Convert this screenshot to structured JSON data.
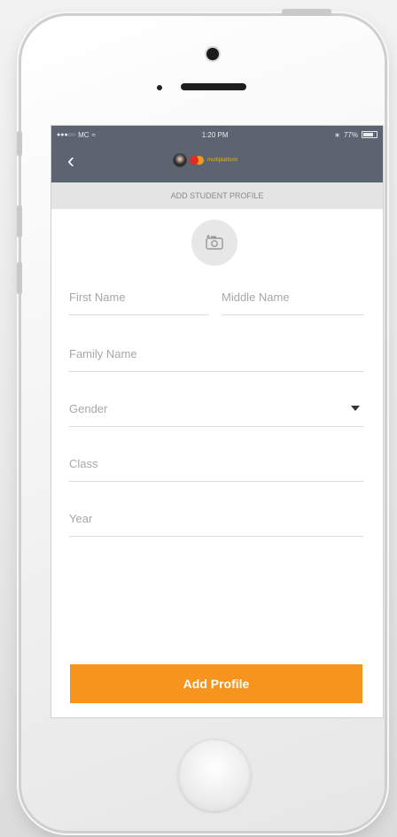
{
  "status_bar": {
    "carrier": "MC",
    "time": "1:20 PM",
    "battery_percent": "77%"
  },
  "nav": {
    "back_icon": "chevron-left-icon",
    "logo_text": "multiplatform"
  },
  "page": {
    "title": "ADD STUDENT PROFILE",
    "photo_icon": "camera-add-icon"
  },
  "form": {
    "first_name_placeholder": "First Name",
    "middle_name_placeholder": "Middle Name",
    "family_name_placeholder": "Family Name",
    "gender_placeholder": "Gender",
    "class_placeholder": "Class",
    "year_placeholder": "Year",
    "submit_label": "Add Profile"
  },
  "colors": {
    "header_bg": "#5b6470",
    "subheader_bg": "#e4e4e4",
    "accent": "#f7941d"
  }
}
